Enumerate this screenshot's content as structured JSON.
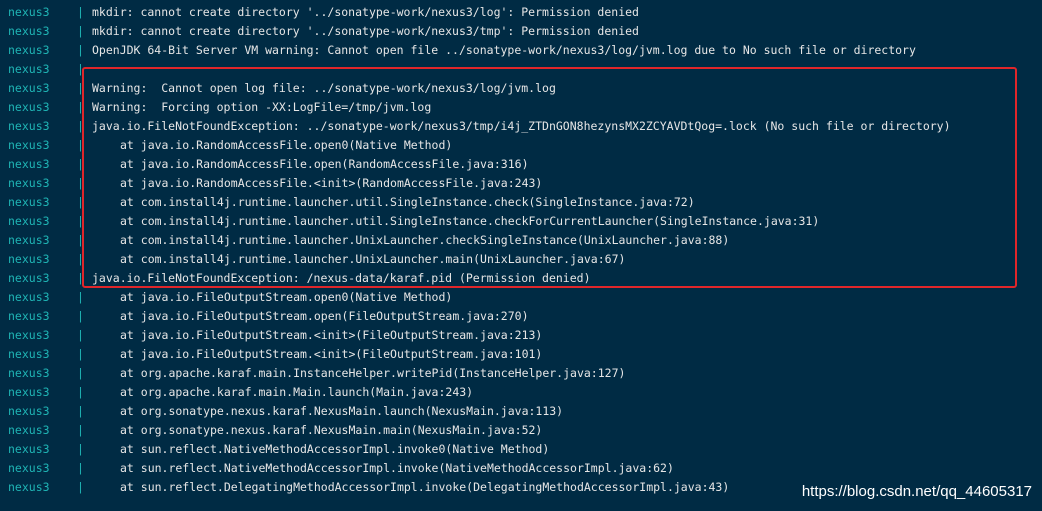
{
  "terminal": {
    "lines": [
      {
        "service": "nexus3",
        "separator": "|",
        "message": "mkdir: cannot create directory '../sonatype-work/nexus3/log': Permission denied",
        "indent": false
      },
      {
        "service": "nexus3",
        "separator": "|",
        "message": "mkdir: cannot create directory '../sonatype-work/nexus3/tmp': Permission denied",
        "indent": false
      },
      {
        "service": "nexus3",
        "separator": "|",
        "message": "OpenJDK 64-Bit Server VM warning: Cannot open file ../sonatype-work/nexus3/log/jvm.log due to No such file or directory",
        "indent": false
      },
      {
        "service": "nexus3",
        "separator": "|",
        "message": "",
        "indent": false
      },
      {
        "service": "nexus3",
        "separator": "|",
        "message": "Warning:  Cannot open log file: ../sonatype-work/nexus3/log/jvm.log",
        "indent": false
      },
      {
        "service": "nexus3",
        "separator": "|",
        "message": "Warning:  Forcing option -XX:LogFile=/tmp/jvm.log",
        "indent": false
      },
      {
        "service": "nexus3",
        "separator": "|",
        "message": "java.io.FileNotFoundException: ../sonatype-work/nexus3/tmp/i4j_ZTDnGON8hezynsMX2ZCYAVDtQog=.lock (No such file or directory)",
        "indent": false
      },
      {
        "service": "nexus3",
        "separator": "|",
        "message": "at java.io.RandomAccessFile.open0(Native Method)",
        "indent": true
      },
      {
        "service": "nexus3",
        "separator": "|",
        "message": "at java.io.RandomAccessFile.open(RandomAccessFile.java:316)",
        "indent": true
      },
      {
        "service": "nexus3",
        "separator": "|",
        "message": "at java.io.RandomAccessFile.<init>(RandomAccessFile.java:243)",
        "indent": true
      },
      {
        "service": "nexus3",
        "separator": "|",
        "message": "at com.install4j.runtime.launcher.util.SingleInstance.check(SingleInstance.java:72)",
        "indent": true
      },
      {
        "service": "nexus3",
        "separator": "|",
        "message": "at com.install4j.runtime.launcher.util.SingleInstance.checkForCurrentLauncher(SingleInstance.java:31)",
        "indent": true
      },
      {
        "service": "nexus3",
        "separator": "|",
        "message": "at com.install4j.runtime.launcher.UnixLauncher.checkSingleInstance(UnixLauncher.java:88)",
        "indent": true
      },
      {
        "service": "nexus3",
        "separator": "|",
        "message": "at com.install4j.runtime.launcher.UnixLauncher.main(UnixLauncher.java:67)",
        "indent": true
      },
      {
        "service": "nexus3",
        "separator": "|",
        "message": "java.io.FileNotFoundException: /nexus-data/karaf.pid (Permission denied)",
        "indent": false
      },
      {
        "service": "nexus3",
        "separator": "|",
        "message": "at java.io.FileOutputStream.open0(Native Method)",
        "indent": true
      },
      {
        "service": "nexus3",
        "separator": "|",
        "message": "at java.io.FileOutputStream.open(FileOutputStream.java:270)",
        "indent": true
      },
      {
        "service": "nexus3",
        "separator": "|",
        "message": "at java.io.FileOutputStream.<init>(FileOutputStream.java:213)",
        "indent": true
      },
      {
        "service": "nexus3",
        "separator": "|",
        "message": "at java.io.FileOutputStream.<init>(FileOutputStream.java:101)",
        "indent": true
      },
      {
        "service": "nexus3",
        "separator": "|",
        "message": "at org.apache.karaf.main.InstanceHelper.writePid(InstanceHelper.java:127)",
        "indent": true
      },
      {
        "service": "nexus3",
        "separator": "|",
        "message": "at org.apache.karaf.main.Main.launch(Main.java:243)",
        "indent": true
      },
      {
        "service": "nexus3",
        "separator": "|",
        "message": "at org.sonatype.nexus.karaf.NexusMain.launch(NexusMain.java:113)",
        "indent": true
      },
      {
        "service": "nexus3",
        "separator": "|",
        "message": "at org.sonatype.nexus.karaf.NexusMain.main(NexusMain.java:52)",
        "indent": true
      },
      {
        "service": "nexus3",
        "separator": "|",
        "message": "at sun.reflect.NativeMethodAccessorImpl.invoke0(Native Method)",
        "indent": true
      },
      {
        "service": "nexus3",
        "separator": "|",
        "message": "at sun.reflect.NativeMethodAccessorImpl.invoke(NativeMethodAccessorImpl.java:62)",
        "indent": true
      },
      {
        "service": "nexus3",
        "separator": "|",
        "message": "at sun.reflect.DelegatingMethodAccessorImpl.invoke(DelegatingMethodAccessorImpl.java:43)",
        "indent": true
      }
    ]
  },
  "watermark": "https://blog.csdn.net/qq_44605317",
  "colors": {
    "background": "#002b44",
    "service_prefix": "#1fb5b5",
    "log_text": "#e6e6e6",
    "highlight_border": "#e0262a",
    "watermark": "#ffffff"
  }
}
